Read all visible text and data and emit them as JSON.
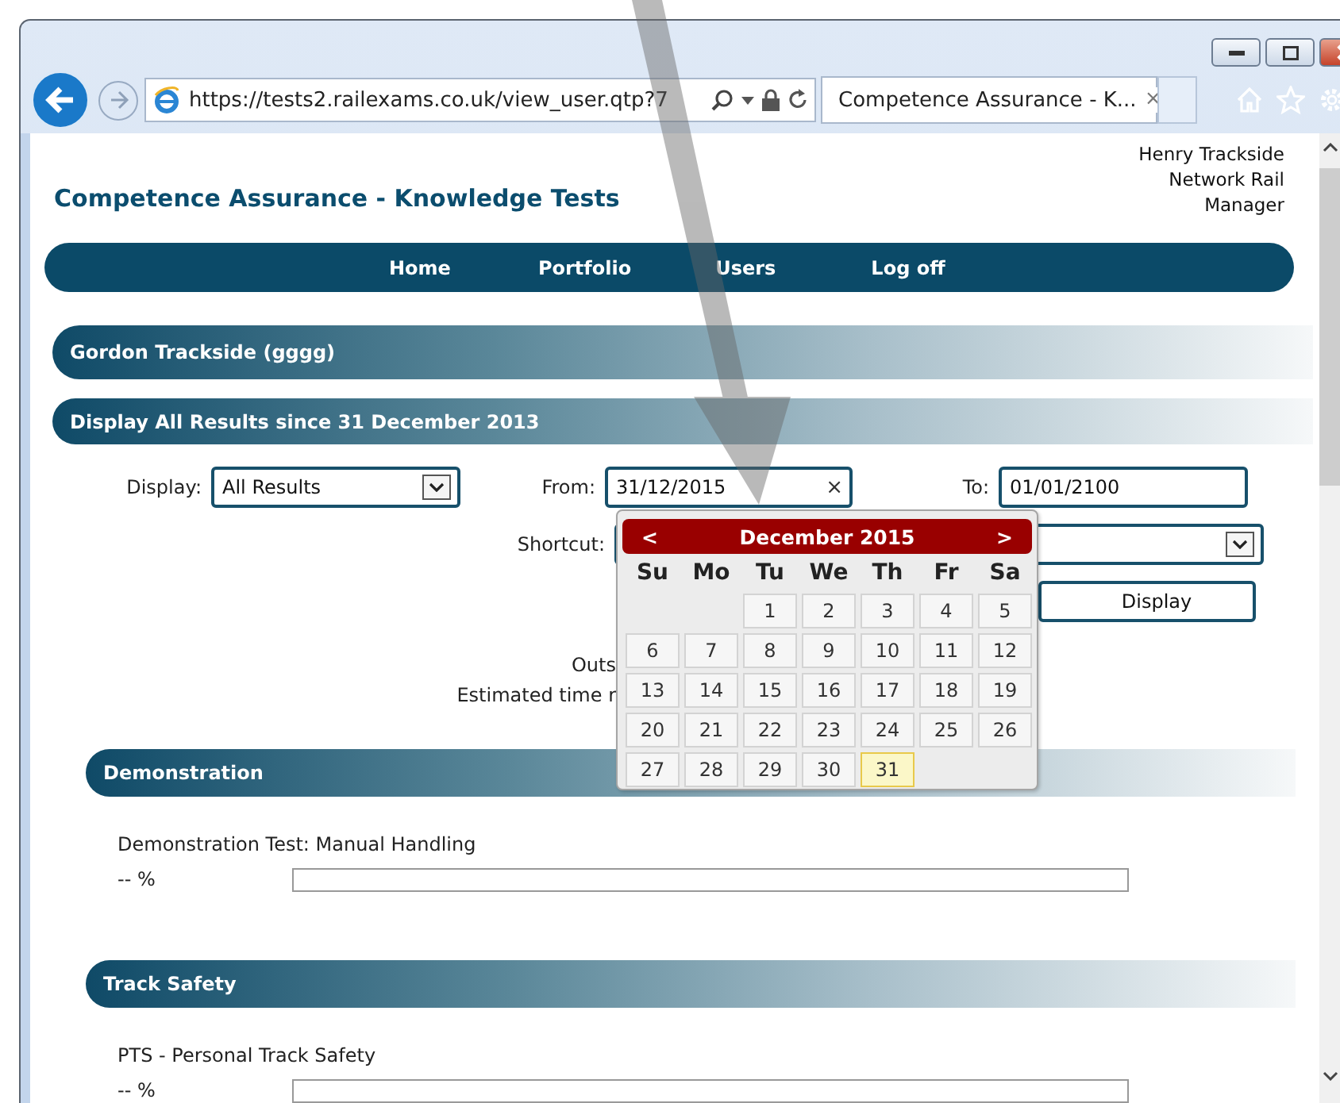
{
  "browser": {
    "address": "https://tests2.railexams.co.uk/view_user.qtp?7",
    "tab_title": "Competence Assurance - K...",
    "tab_close": "×"
  },
  "page": {
    "title": "Competence Assurance - Knowledge Tests",
    "user": [
      "Henry Trackside",
      "Network Rail",
      "Manager"
    ]
  },
  "nav": [
    {
      "label": "Home"
    },
    {
      "label": "Portfolio"
    },
    {
      "label": "Users"
    },
    {
      "label": "Log off"
    }
  ],
  "user_bar": "Gordon Trackside (gggg)",
  "filter": {
    "heading": "Display All Results since 31 December 2013",
    "display_label": "Display:",
    "display_value": "All Results",
    "from_label": "From:",
    "from_value": "31/12/2015",
    "clear": "×",
    "to_label": "To:",
    "to_value": "01/01/2100",
    "shortcut_label": "Shortcut:",
    "button": "Display"
  },
  "summary": [
    "Outs",
    "Estimated time r"
  ],
  "calendar": {
    "prev": "<",
    "month": "December 2015",
    "next": ">",
    "weekdays": [
      "Su",
      "Mo",
      "Tu",
      "We",
      "Th",
      "Fr",
      "Sa"
    ],
    "weeks": [
      [
        {
          "label": "1",
          "selected": false
        },
        {
          "label": "2",
          "selected": false
        },
        {
          "label": "3",
          "selected": false
        },
        {
          "label": "4",
          "selected": false
        },
        {
          "label": "5",
          "selected": false
        }
      ],
      [
        {
          "label": "6",
          "selected": false
        },
        {
          "label": "7",
          "selected": false
        },
        {
          "label": "8",
          "selected": false
        },
        {
          "label": "9",
          "selected": false
        },
        {
          "label": "10",
          "selected": false
        },
        {
          "label": "11",
          "selected": false
        },
        {
          "label": "12",
          "selected": false
        }
      ],
      [
        {
          "label": "13",
          "selected": false
        },
        {
          "label": "14",
          "selected": false
        },
        {
          "label": "15",
          "selected": false
        },
        {
          "label": "16",
          "selected": false
        },
        {
          "label": "17",
          "selected": false
        },
        {
          "label": "18",
          "selected": false
        },
        {
          "label": "19",
          "selected": false
        }
      ],
      [
        {
          "label": "20",
          "selected": false
        },
        {
          "label": "21",
          "selected": false
        },
        {
          "label": "22",
          "selected": false
        },
        {
          "label": "23",
          "selected": false
        },
        {
          "label": "24",
          "selected": false
        },
        {
          "label": "25",
          "selected": false
        },
        {
          "label": "26",
          "selected": false
        }
      ],
      [
        {
          "label": "27",
          "selected": false
        },
        {
          "label": "28",
          "selected": false
        },
        {
          "label": "29",
          "selected": false
        },
        {
          "label": "30",
          "selected": false
        },
        {
          "label": "31",
          "selected": true
        }
      ]
    ]
  },
  "sections": [
    {
      "title": "Demonstration",
      "tests": [
        {
          "name": "Demonstration Test: Manual Handling",
          "score": "-- %"
        }
      ]
    },
    {
      "title": "Track Safety",
      "tests": [
        {
          "name": "PTS - Personal Track Safety",
          "score": "-- %"
        }
      ]
    }
  ]
}
